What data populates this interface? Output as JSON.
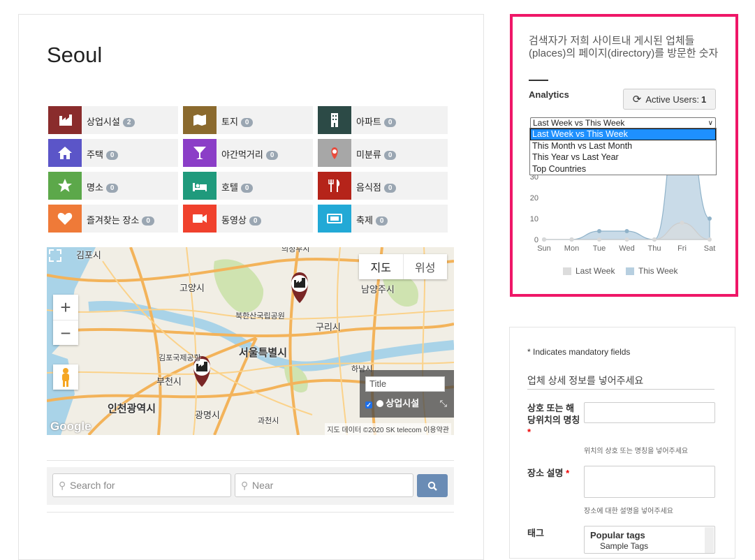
{
  "page": {
    "title": "Seoul"
  },
  "categories": [
    {
      "label": "상업시설",
      "count": "2",
      "color": "#8a2c2c",
      "icon": "factory-icon"
    },
    {
      "label": "토지",
      "count": "0",
      "color": "#8b6a2e",
      "icon": "map-icon"
    },
    {
      "label": "아파트",
      "count": "0",
      "color": "#2c4a46",
      "icon": "building-icon"
    },
    {
      "label": "주택",
      "count": "0",
      "color": "#5b55c8",
      "icon": "house-icon"
    },
    {
      "label": "야간먹거리",
      "count": "0",
      "color": "#8b3ec7",
      "icon": "cocktail-icon"
    },
    {
      "label": "미분류",
      "count": "0",
      "color": "#a7a7a7",
      "icon": "pin-icon"
    },
    {
      "label": "명소",
      "count": "0",
      "color": "#5ca84a",
      "icon": "star-icon"
    },
    {
      "label": "호텔",
      "count": "0",
      "color": "#1f9a7c",
      "icon": "bed-icon"
    },
    {
      "label": "음식점",
      "count": "0",
      "color": "#b5241a",
      "icon": "cutlery-icon"
    },
    {
      "label": "즐겨찾는 장소",
      "count": "0",
      "color": "#ef7a38",
      "icon": "heart-icon"
    },
    {
      "label": "동영상",
      "count": "0",
      "color": "#f0412d",
      "icon": "video-icon"
    },
    {
      "label": "축제",
      "count": "0",
      "color": "#22a9d6",
      "icon": "ticket-icon"
    }
  ],
  "map": {
    "type_map": "지도",
    "type_satellite": "위성",
    "zoom_in": "+",
    "zoom_out": "−",
    "legend_title_placeholder": "Title",
    "legend_item": "상업시설",
    "attribution": "지도 데이터 ©2020 SK telecom    이용약관",
    "google": "Google",
    "places": [
      "김포시",
      "고양시",
      "남양주시",
      "북한산국립공원",
      "구리시",
      "서울특별시",
      "김포국제공항",
      "부천시",
      "인천광역시",
      "광명시",
      "과천시",
      "하남시",
      "의정부시"
    ]
  },
  "search": {
    "placeholder": "Search for",
    "near_placeholder": "Near"
  },
  "analytics": {
    "heading": "검색자가 저희 사이트내 게시된 업체들(places)의 페이지(directory)를 방문한 숫자",
    "label": "Analytics",
    "active_users_label": "Active Users:",
    "active_users_count": "1",
    "selected_range": "Last Week vs This Week",
    "range_options": [
      "Last Week vs This Week",
      "This Month vs Last Month",
      "This Year vs Last Year",
      "Top Countries"
    ]
  },
  "chart_data": {
    "type": "area",
    "categories": [
      "Sun",
      "Mon",
      "Tue",
      "Wed",
      "Thu",
      "Fri",
      "Sat"
    ],
    "series": [
      {
        "name": "Last Week",
        "values": [
          0,
          0,
          0,
          0,
          0,
          8,
          0
        ],
        "color": "#dcdcdc"
      },
      {
        "name": "This Week",
        "values": [
          0,
          0,
          4,
          4,
          0,
          75,
          10
        ],
        "color": "#b7cfe0"
      }
    ],
    "y_ticks": [
      "0",
      "10",
      "20",
      "30"
    ],
    "ylim": [
      0,
      30
    ]
  },
  "form": {
    "mandatory_note": "*  Indicates mandatory fields",
    "section_title": "업체 상세 정보를 넣어주세요",
    "name_label": "상호 또는 해당위치의 명칭",
    "name_help": "위치의 상호 또는 명칭을 넣어주세요",
    "desc_label": "장소 설명",
    "desc_help": "장소에 대한 설명을 넣어주세요",
    "tags_label": "태그",
    "tags_popular": "Popular tags",
    "tags_sample": "Sample Tags",
    "required_mark": "*"
  }
}
